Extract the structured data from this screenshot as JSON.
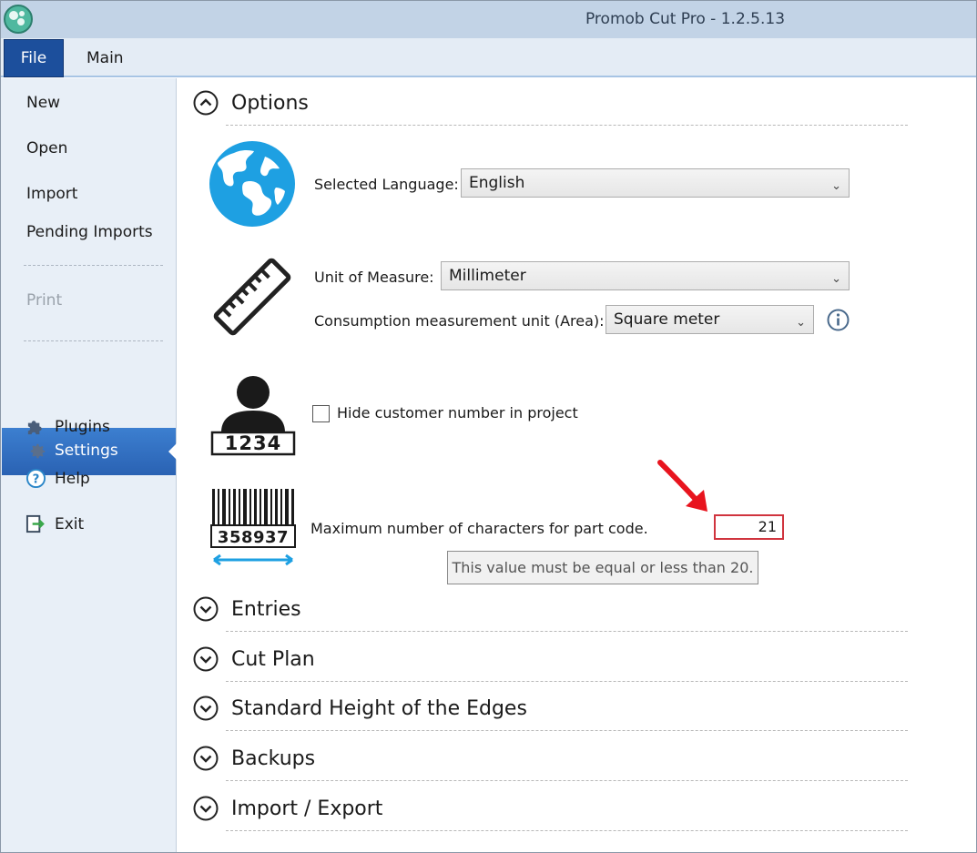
{
  "window": {
    "title": "Promob Cut Pro - 1.2.5.13"
  },
  "ribbon": {
    "tabs": [
      "File",
      "Main"
    ]
  },
  "sidebar": {
    "items": [
      {
        "label": "New"
      },
      {
        "label": "Open"
      },
      {
        "label": "Import"
      },
      {
        "label": "Pending Imports"
      },
      {
        "label": "Print",
        "disabled": true
      },
      {
        "label": "Settings",
        "selected": true,
        "icon": "gear-icon"
      },
      {
        "label": "Plugins",
        "icon": "puzzle-icon"
      },
      {
        "label": "Help",
        "icon": "help-icon"
      },
      {
        "label": "Exit",
        "icon": "exit-icon"
      }
    ]
  },
  "options": {
    "title": "Options",
    "language": {
      "label": "Selected Language:",
      "value": "English"
    },
    "unit": {
      "label": "Unit of Measure:",
      "value": "Millimeter"
    },
    "consumption": {
      "label": "Consumption measurement unit (Area):",
      "value": "Square meter"
    },
    "customer_number": {
      "label": "Hide customer number in project",
      "checked": false,
      "badge": "1234"
    },
    "part_code": {
      "label": "Maximum number of characters for part code.",
      "value": "21",
      "error": "This value must be equal or less than 20.",
      "barcode_number": "358937"
    }
  },
  "sections": [
    "Entries",
    "Cut Plan",
    "Standard Height of the Edges",
    "Backups",
    "Import / Export"
  ],
  "colors": {
    "accent": "#2a62b3",
    "error": "#d0343e",
    "globe": "#1ea0e2"
  }
}
